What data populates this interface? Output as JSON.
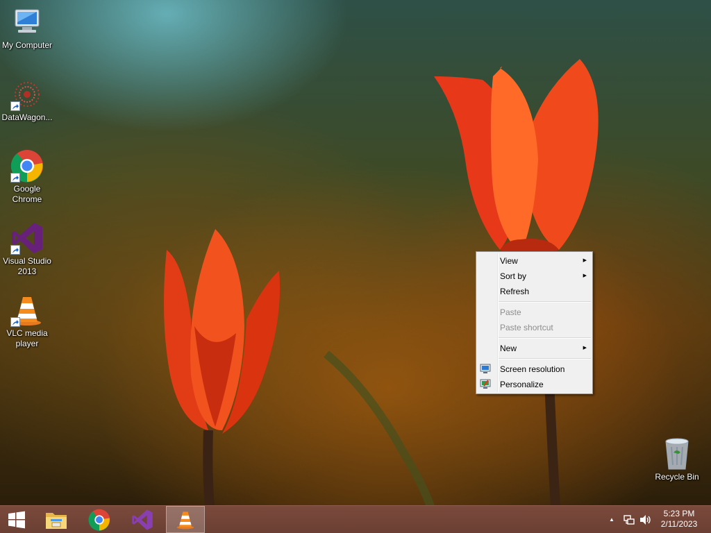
{
  "desktop": {
    "icons": [
      {
        "label": "My Computer",
        "icon": "computer-icon"
      },
      {
        "label": "DataWagon...",
        "icon": "datawagon-icon",
        "shortcut": true
      },
      {
        "label": "Google\nChrome",
        "icon": "chrome-icon",
        "shortcut": true
      },
      {
        "label": "Visual Studio\n2013",
        "icon": "visual-studio-icon",
        "shortcut": true
      },
      {
        "label": "VLC media\nplayer",
        "icon": "vlc-icon",
        "shortcut": true
      }
    ],
    "recycle_bin": {
      "label": "Recycle Bin",
      "icon": "recycle-bin-icon"
    }
  },
  "context_menu": {
    "items": [
      {
        "label": "View",
        "submenu": true,
        "enabled": true
      },
      {
        "label": "Sort by",
        "submenu": true,
        "enabled": true
      },
      {
        "label": "Refresh",
        "enabled": true
      },
      {
        "label": "Paste",
        "enabled": false
      },
      {
        "label": "Paste shortcut",
        "enabled": false
      },
      {
        "label": "New",
        "submenu": true,
        "enabled": true
      },
      {
        "label": "Screen resolution",
        "icon": "screen-resolution-icon",
        "enabled": true
      },
      {
        "label": "Personalize",
        "icon": "personalize-icon",
        "enabled": true
      }
    ],
    "submenu_arrow": "▶"
  },
  "taskbar": {
    "start": {
      "icon": "windows-logo-icon"
    },
    "pinned": [
      {
        "icon": "file-explorer-icon"
      },
      {
        "icon": "chrome-icon"
      },
      {
        "icon": "visual-studio-icon"
      },
      {
        "icon": "vlc-icon",
        "active": true
      }
    ],
    "tray": {
      "show_hidden_icon": "▲",
      "network_icon": "network-icon",
      "volume_icon": "volume-icon"
    },
    "clock": {
      "time": "5:23 PM",
      "date": "2/11/2023"
    }
  },
  "colors": {
    "taskbar": "#6b3f33",
    "menu_background": "#f0f0f0",
    "disabled_text": "#8d8d8d",
    "flower": "#f0451a"
  }
}
